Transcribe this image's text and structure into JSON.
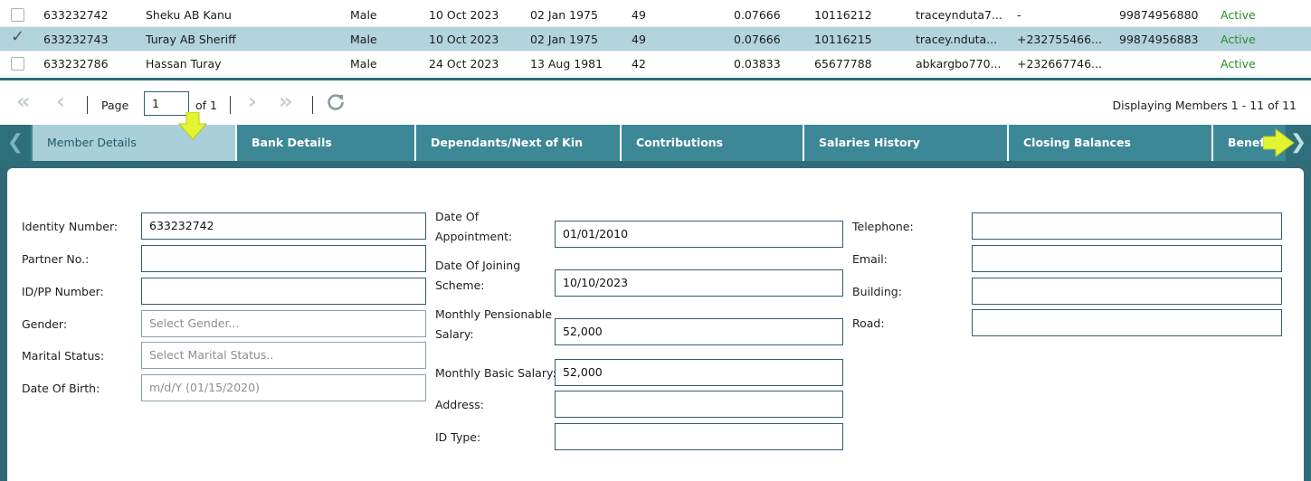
{
  "grid": {
    "rows": [
      {
        "id": "633232742",
        "name": "Sheku AB Kanu",
        "gender": "Male",
        "date1": "10 Oct 2023",
        "dob": "02 Jan 1975",
        "age": "49",
        "rate": "0.07666",
        "num": "10116212",
        "email": "traceynduta7...",
        "phone": "-",
        "account": "99874956880",
        "status": "Active",
        "selected": false
      },
      {
        "id": "633232743",
        "name": "Turay AB Sheriff",
        "gender": "Male",
        "date1": "10 Oct 2023",
        "dob": "02 Jan 1975",
        "age": "49",
        "rate": "0.07666",
        "num": "10116215",
        "email": "tracey.nduta...",
        "phone": "+232755466...",
        "account": "99874956883",
        "status": "Active",
        "selected": true
      },
      {
        "id": "633232786",
        "name": "Hassan Turay",
        "gender": "Male",
        "date1": "24 Oct 2023",
        "dob": "13 Aug 1981",
        "age": "42",
        "rate": "0.03833",
        "num": "65677788",
        "email": "abkargbo770...",
        "phone": "+232667746...",
        "account": "",
        "status": "Active",
        "selected": false
      }
    ]
  },
  "pager": {
    "first_icon": "first-page-icon",
    "prev_icon": "prev-page-icon",
    "page_label": "Page",
    "page_value": "1",
    "of_label": "of 1",
    "next_icon": "next-page-icon",
    "last_icon": "last-page-icon",
    "refresh_icon": "refresh-icon",
    "display_text": "Displaying Members 1 - 11 of 11"
  },
  "tabs": {
    "items": [
      {
        "label": "Member Details",
        "active": true
      },
      {
        "label": "Bank Details"
      },
      {
        "label": "Dependants/Next of Kin"
      },
      {
        "label": "Contributions"
      },
      {
        "label": "Salaries History"
      },
      {
        "label": "Closing Balances"
      },
      {
        "label": "Benefi"
      }
    ]
  },
  "form": {
    "col1": [
      {
        "label": "Identity Number:",
        "value": "633232742"
      },
      {
        "label": "Partner No.:",
        "value": ""
      },
      {
        "label": "ID/PP Number:",
        "value": ""
      },
      {
        "label": "Gender:",
        "placeholder": "Select Gender..."
      },
      {
        "label": "Marital Status:",
        "placeholder": "Select Marital Status.."
      },
      {
        "label": "Date Of Birth:",
        "placeholder": "m/d/Y (01/15/2020)"
      }
    ],
    "col2": [
      {
        "label_line1": "Date Of",
        "label_line2": "Appointment:",
        "value": "01/01/2010"
      },
      {
        "label_line1": "Date Of Joining",
        "label_line2": "Scheme:",
        "value": "10/10/2023"
      },
      {
        "label_line1": "Monthly Pensionable",
        "label_line2": "Salary:",
        "value": "52,000"
      },
      {
        "label": "Monthly Basic Salary:",
        "value": "52,000"
      },
      {
        "label": "Address:",
        "value": ""
      },
      {
        "label": "ID Type:",
        "value": ""
      }
    ],
    "col3": [
      {
        "label": "Telephone:",
        "value": ""
      },
      {
        "label": "Email:",
        "value": ""
      },
      {
        "label": "Building:",
        "value": ""
      },
      {
        "label": "Road:",
        "value": ""
      }
    ]
  },
  "colors": {
    "accent": "#3d8896",
    "dark_accent": "#2f6c78",
    "selected_row": "#b3d3dd",
    "active_tab": "#a9cfd9",
    "status_active": "#2b8a2b",
    "marker": "#e2f530"
  }
}
